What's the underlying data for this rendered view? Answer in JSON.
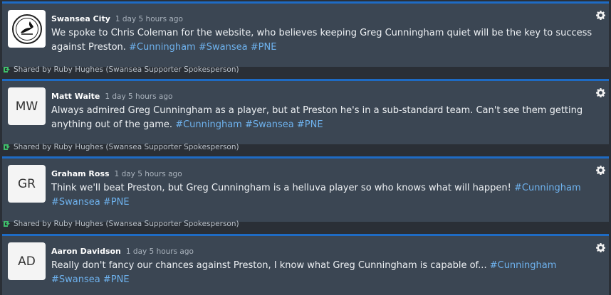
{
  "posts": [
    {
      "author": "Swansea City",
      "time": "1 day 5 hours ago",
      "avatar": "",
      "avatar_icon": "swansea-city-crest",
      "message": "We spoke to Chris Coleman for the website, who believes keeping Greg Cunningham quiet will be the key to success against Preston.",
      "tags": [
        "#Cunningham",
        "#Swansea",
        "#PNE"
      ],
      "shared": "Shared by Ruby Hughes (Swansea Supporter Spokesperson)"
    },
    {
      "author": "Matt Waite",
      "time": "1 day 5 hours ago",
      "avatar": "MW",
      "message": "Always admired Greg Cunningham as a player, but at Preston he's in a sub-standard team. Can't see them getting anything out of the game.",
      "tags": [
        "#Cunningham",
        "#Swansea",
        "#PNE"
      ],
      "shared": "Shared by Ruby Hughes (Swansea Supporter Spokesperson)"
    },
    {
      "author": "Graham Ross",
      "time": "1 day 5 hours ago",
      "avatar": "GR",
      "message": "Think we'll beat Preston, but Greg Cunningham is a helluva player so who knows what will happen!",
      "tags": [
        "#Cunningham",
        "#Swansea",
        "#PNE"
      ],
      "shared": "Shared by Ruby Hughes (Swansea Supporter Spokesperson)"
    },
    {
      "author": "Aaron Davidson",
      "time": "1 day 5 hours ago",
      "avatar": "AD",
      "message": "Really don't fancy our chances against Preston, I know what Greg Cunningham is capable of...",
      "tags": [
        "#Cunningham",
        "#Swansea",
        "#PNE"
      ],
      "shared": ""
    }
  ],
  "colors": {
    "accent": "#1e6bc4",
    "card": "#3b4653",
    "background": "#2a2f36",
    "hashtag": "#6eb2ee",
    "share_icon": "#3fbf6a"
  }
}
